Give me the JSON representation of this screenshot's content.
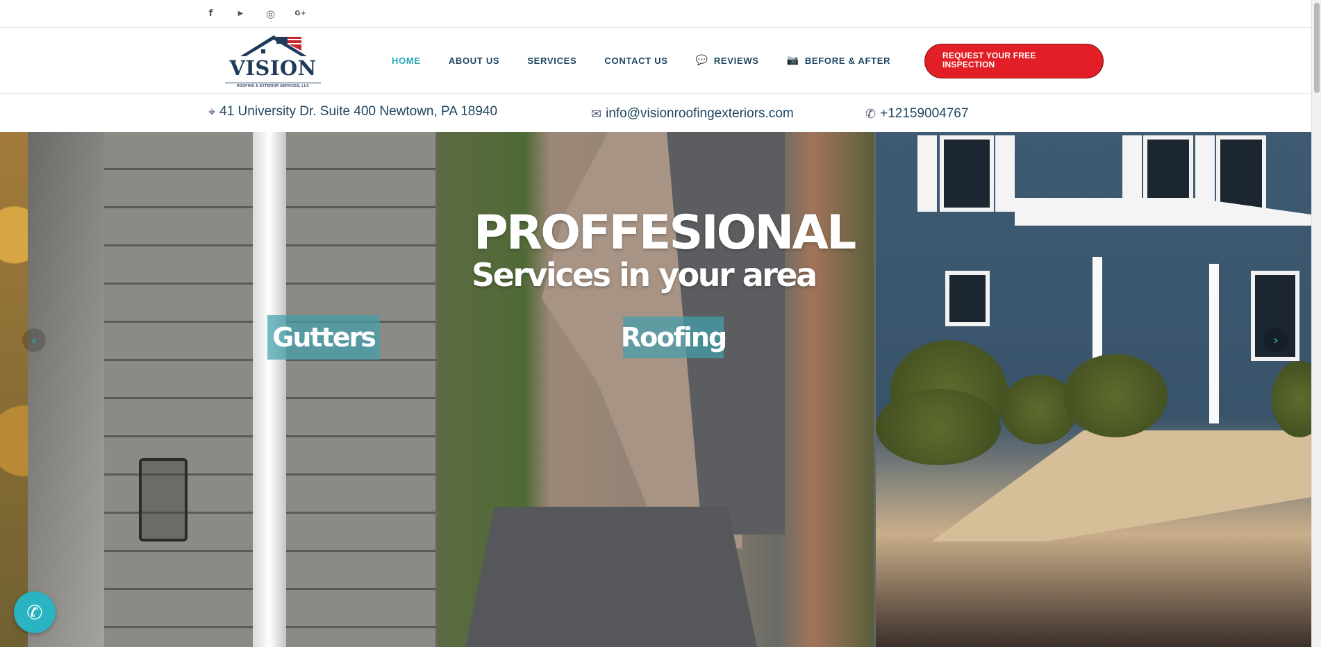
{
  "social": {
    "items": [
      {
        "name": "facebook",
        "glyph": "f"
      },
      {
        "name": "youtube",
        "glyph": "▶"
      },
      {
        "name": "instagram",
        "glyph": "◎"
      },
      {
        "name": "google-plus",
        "glyph": "G+"
      }
    ]
  },
  "logo": {
    "brand": "VISION",
    "tagline": "ROOFING & EXTERIOR SERVICES, LLC"
  },
  "nav": {
    "items": [
      {
        "label": "HOME",
        "icon": ""
      },
      {
        "label": "ABOUT US",
        "icon": ""
      },
      {
        "label": "SERVICES",
        "icon": ""
      },
      {
        "label": "CONTACT US",
        "icon": ""
      },
      {
        "label": "REVIEWS",
        "icon": "💬"
      },
      {
        "label": "BEFORE & AFTER",
        "icon": "📷"
      }
    ],
    "active": "HOME"
  },
  "cta": {
    "label": "REQUEST YOUR FREE INSPECTION"
  },
  "contact": {
    "address": "41 University Dr. Suite 400 Newtown, PA 18940",
    "email": "info@visionroofingexteriors.com",
    "phone": "+12159004767"
  },
  "hero": {
    "headline_line1": "PROFFESIONAL",
    "headline_line2": "Services in your area",
    "labels": [
      "Gutters",
      "Roofing"
    ],
    "prev_arrow": "‹",
    "next_arrow": "›"
  },
  "call_button": {
    "glyph": "✆"
  },
  "colors": {
    "brand_navy": "#1d4560",
    "accent_teal": "#2aa7b6",
    "cta_red": "#e21f26"
  }
}
